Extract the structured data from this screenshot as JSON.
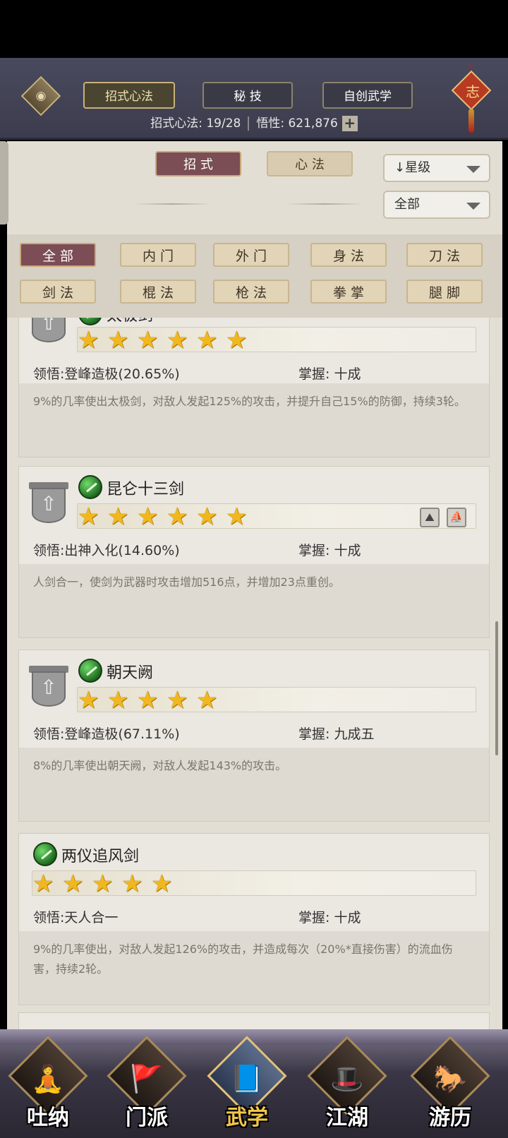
{
  "header": {
    "tabs": [
      {
        "label": "招式心法",
        "active": true
      },
      {
        "label": "秘 技",
        "active": false
      },
      {
        "label": "自创武学",
        "active": false
      }
    ],
    "stats": {
      "count_label": "招式心法:",
      "count_value": "19/28",
      "insight_label": "悟性:",
      "insight_value": "621,876",
      "plus": "+"
    },
    "knot_char": "志",
    "eye_icon": "◉"
  },
  "subtabs": [
    {
      "label": "招 式",
      "active": true
    },
    {
      "label": "心 法",
      "active": false
    }
  ],
  "sort": {
    "value": "↓星级",
    "arrow_icon": "chevron-down"
  },
  "filter_select": {
    "value": "全部"
  },
  "filters": [
    {
      "label": "全 部",
      "active": true
    },
    {
      "label": "内 门"
    },
    {
      "label": "外 门"
    },
    {
      "label": "身 法"
    },
    {
      "label": "刀 法"
    },
    {
      "label": "剑 法"
    },
    {
      "label": "棍 法"
    },
    {
      "label": "枪 法"
    },
    {
      "label": "拳 掌"
    },
    {
      "label": "腿 脚"
    }
  ],
  "skills": [
    {
      "name": "太极剑",
      "stars": 6,
      "comprehension_label": "领悟:",
      "comprehension": "登峰造极(20.65%)",
      "mastery_label": "掌握:",
      "mastery": "十成",
      "desc": "9%的几率使出太极剑，对敌人发起125%的攻击，并提升自己15%的防御，持续3轮。"
    },
    {
      "name": "昆仑十三剑",
      "stars": 6,
      "comprehension_label": "领悟:",
      "comprehension": "出神入化(14.60%)",
      "mastery_label": "掌握:",
      "mastery": "十成",
      "desc": "人剑合一，使剑为武器时攻击增加516点，并增加23点重创。"
    },
    {
      "name": "朝天阙",
      "stars": 5,
      "comprehension_label": "领悟:",
      "comprehension": "登峰造极(67.11%)",
      "mastery_label": "掌握:",
      "mastery": "九成五",
      "desc": "8%的几率使出朝天阙，对敌人发起143%的攻击。"
    },
    {
      "name": "两仪追风剑",
      "stars": 5,
      "comprehension_label": "领悟:",
      "comprehension": "天人合一",
      "mastery_label": "掌握:",
      "mastery": "十成",
      "desc": "9%的几率使出，对敌人发起126%的攻击，并造成每次（20%*直接伤害）的流血伤害，持续2轮。"
    }
  ],
  "nav": [
    {
      "label": "吐纳",
      "glyph": "🧘",
      "active": false
    },
    {
      "label": "门派",
      "glyph": "🚩",
      "active": false
    },
    {
      "label": "武学",
      "glyph": "📘",
      "active": true
    },
    {
      "label": "江湖",
      "glyph": "🎩",
      "active": false
    },
    {
      "label": "游历",
      "glyph": "🐎",
      "active": false
    }
  ],
  "colors": {
    "accent": "#7a4e54",
    "gold": "#f1b81e",
    "header": "#3c3c4e",
    "panel": "#e2ded4"
  }
}
